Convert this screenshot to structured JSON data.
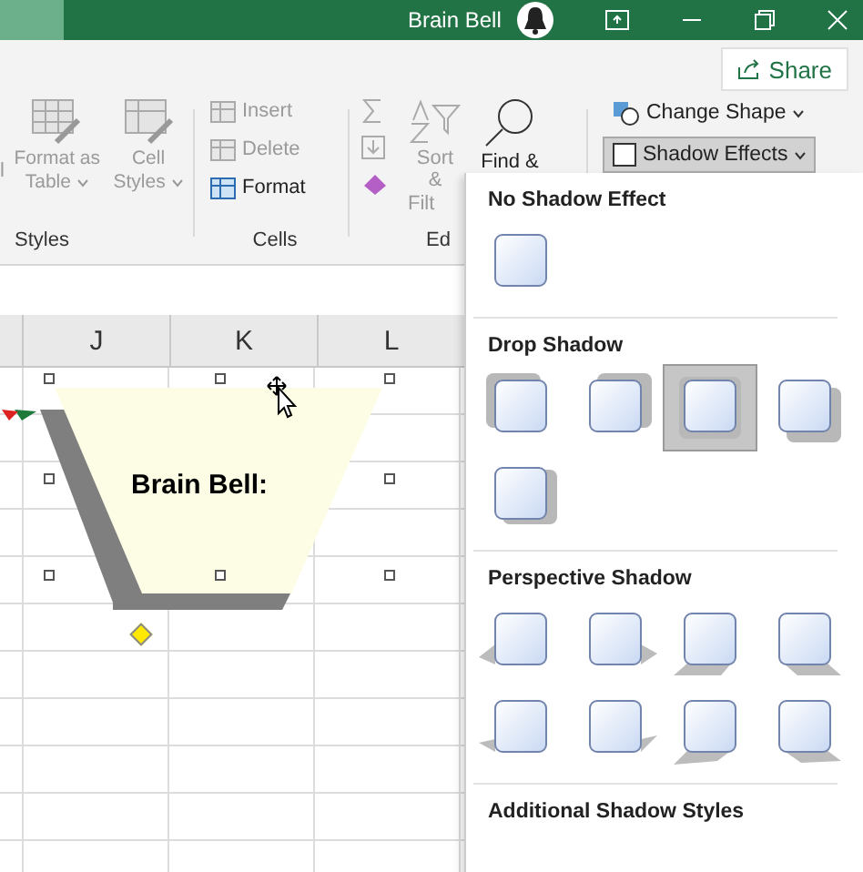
{
  "window": {
    "title": "Brain Bell"
  },
  "share_button": {
    "label": "Share"
  },
  "ribbon": {
    "styles_group": {
      "label": "Styles",
      "cut_label": "l",
      "format_as_table": [
        "Format as",
        "Table"
      ],
      "cell_styles": [
        "Cell",
        "Styles"
      ]
    },
    "cells_group": {
      "label": "Cells",
      "commands": [
        {
          "label": "Insert",
          "disabled": true
        },
        {
          "label": "Delete",
          "disabled": true
        },
        {
          "label": "Format",
          "disabled": false
        }
      ]
    },
    "editing_group": {
      "label": "Ed",
      "sort_filter": [
        "Sort &",
        "Filt"
      ],
      "find": "Find &"
    },
    "shape_commands": [
      {
        "label": "Change Shape",
        "selected": false
      },
      {
        "label": "Shadow Effects",
        "selected": true
      }
    ]
  },
  "sheet": {
    "columns": [
      "J",
      "K",
      "L"
    ],
    "shape_text": "Brain Bell:"
  },
  "shadow_menu": {
    "sections": [
      {
        "title": "No Shadow Effect",
        "options": [
          {
            "kind": "none",
            "selected": false
          }
        ]
      },
      {
        "title": "Drop Shadow",
        "options": [
          {
            "kind": "top-left",
            "selected": false
          },
          {
            "kind": "top-right",
            "selected": false
          },
          {
            "kind": "center",
            "selected": true
          },
          {
            "kind": "bottom-right",
            "selected": false
          },
          {
            "kind": "right",
            "selected": false
          }
        ]
      },
      {
        "title": "Perspective Shadow",
        "options": [
          {
            "kind": "p-left-up",
            "selected": false
          },
          {
            "kind": "p-right-up",
            "selected": false
          },
          {
            "kind": "p-below-left",
            "selected": false
          },
          {
            "kind": "p-below-right",
            "selected": false
          },
          {
            "kind": "p-left-low",
            "selected": false
          },
          {
            "kind": "p-right-low",
            "selected": false
          },
          {
            "kind": "p-under-left",
            "selected": false
          },
          {
            "kind": "p-under-right",
            "selected": false
          }
        ]
      }
    ],
    "footer": "Additional Shadow Styles"
  }
}
